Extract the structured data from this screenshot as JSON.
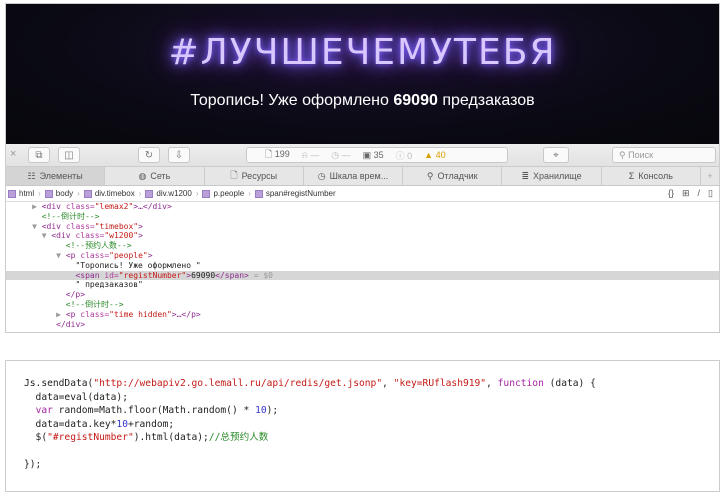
{
  "banner": {
    "hashtag": "#ЛУЧШЕЧЕМУТЕБЯ",
    "headline_prefix": "Торопись! Уже оформлено",
    "headline_number": "69090",
    "headline_suffix": "предзаказов"
  },
  "toolbar": {
    "resources_count": "199",
    "dash1": "—",
    "dash2": "—",
    "logs_count": "35",
    "errors_count": "0",
    "warnings_count": "40",
    "search_placeholder": "Поиск"
  },
  "tabs": [
    {
      "label": "Элементы",
      "icon": "elements-icon"
    },
    {
      "label": "Сеть",
      "icon": "network-icon"
    },
    {
      "label": "Ресурсы",
      "icon": "resources-icon"
    },
    {
      "label": "Шкала врем...",
      "icon": "timeline-icon"
    },
    {
      "label": "Отладчик",
      "icon": "debugger-icon"
    },
    {
      "label": "Хранилище",
      "icon": "storage-icon"
    },
    {
      "label": "Консоль",
      "icon": "console-icon"
    }
  ],
  "breadcrumbs": [
    "html",
    "body",
    "div.timebox",
    "div.w1200",
    "p.people",
    "span#registNumber"
  ],
  "dom": {
    "l1_tag_open": "<div ",
    "l1_attr": "class=",
    "l1_val": "\"lemax2\"",
    "l1_close": ">…</div>",
    "c1": "<!--倒计时-->",
    "l3_tag": "<div ",
    "l3_attr": "class=",
    "l3_val": "\"timebox\"",
    "l3_close": ">",
    "l4_tag": "<div ",
    "l4_attr": "class=",
    "l4_val": "\"w1200\"",
    "l4_close": ">",
    "c2": "<!--预约人数-->",
    "l6_tag": "<p ",
    "l6_attr": "class=",
    "l6_val": "\"people\"",
    "l6_close": ">",
    "t1": "\"Торопись! Уже оформлено \"",
    "s_tag": "<span ",
    "s_attr": "id=",
    "s_val": "\"registNumber\"",
    "s_gt": ">",
    "s_text": "69090",
    "s_close": "</span>",
    "s_ref": " = $0",
    "t2": "\" предзаказов\"",
    "p_close": "</p>",
    "c3": "<!--倒计时-->",
    "l12_tag": "<p ",
    "l12_attr": "class=",
    "l12_val": "\"time hidden\"",
    "l12_close": ">…</p>",
    "div_close": "</div>"
  },
  "code": {
    "l1a": "Js.sendData(",
    "l1b": "\"http://webapiv2.go.lemall.ru/api/redis/get.jsonp\"",
    "l1c": ", ",
    "l1d": "\"key=RUflash919\"",
    "l1e": ", ",
    "l1f": "function",
    "l1g": " (data) {",
    "l2": "  data=eval(data);",
    "l3a": "  ",
    "l3b": "var",
    "l3c": " random=Math.floor(Math.random() * ",
    "l3d": "10",
    "l3e": ");",
    "l4a": "  data=data.key*",
    "l4b": "10",
    "l4c": "+random;",
    "l5a": "  $(",
    "l5b": "\"#registNumber\"",
    "l5c": ").html(data);",
    "l5d": "//总预约人数",
    "l7": "});"
  }
}
